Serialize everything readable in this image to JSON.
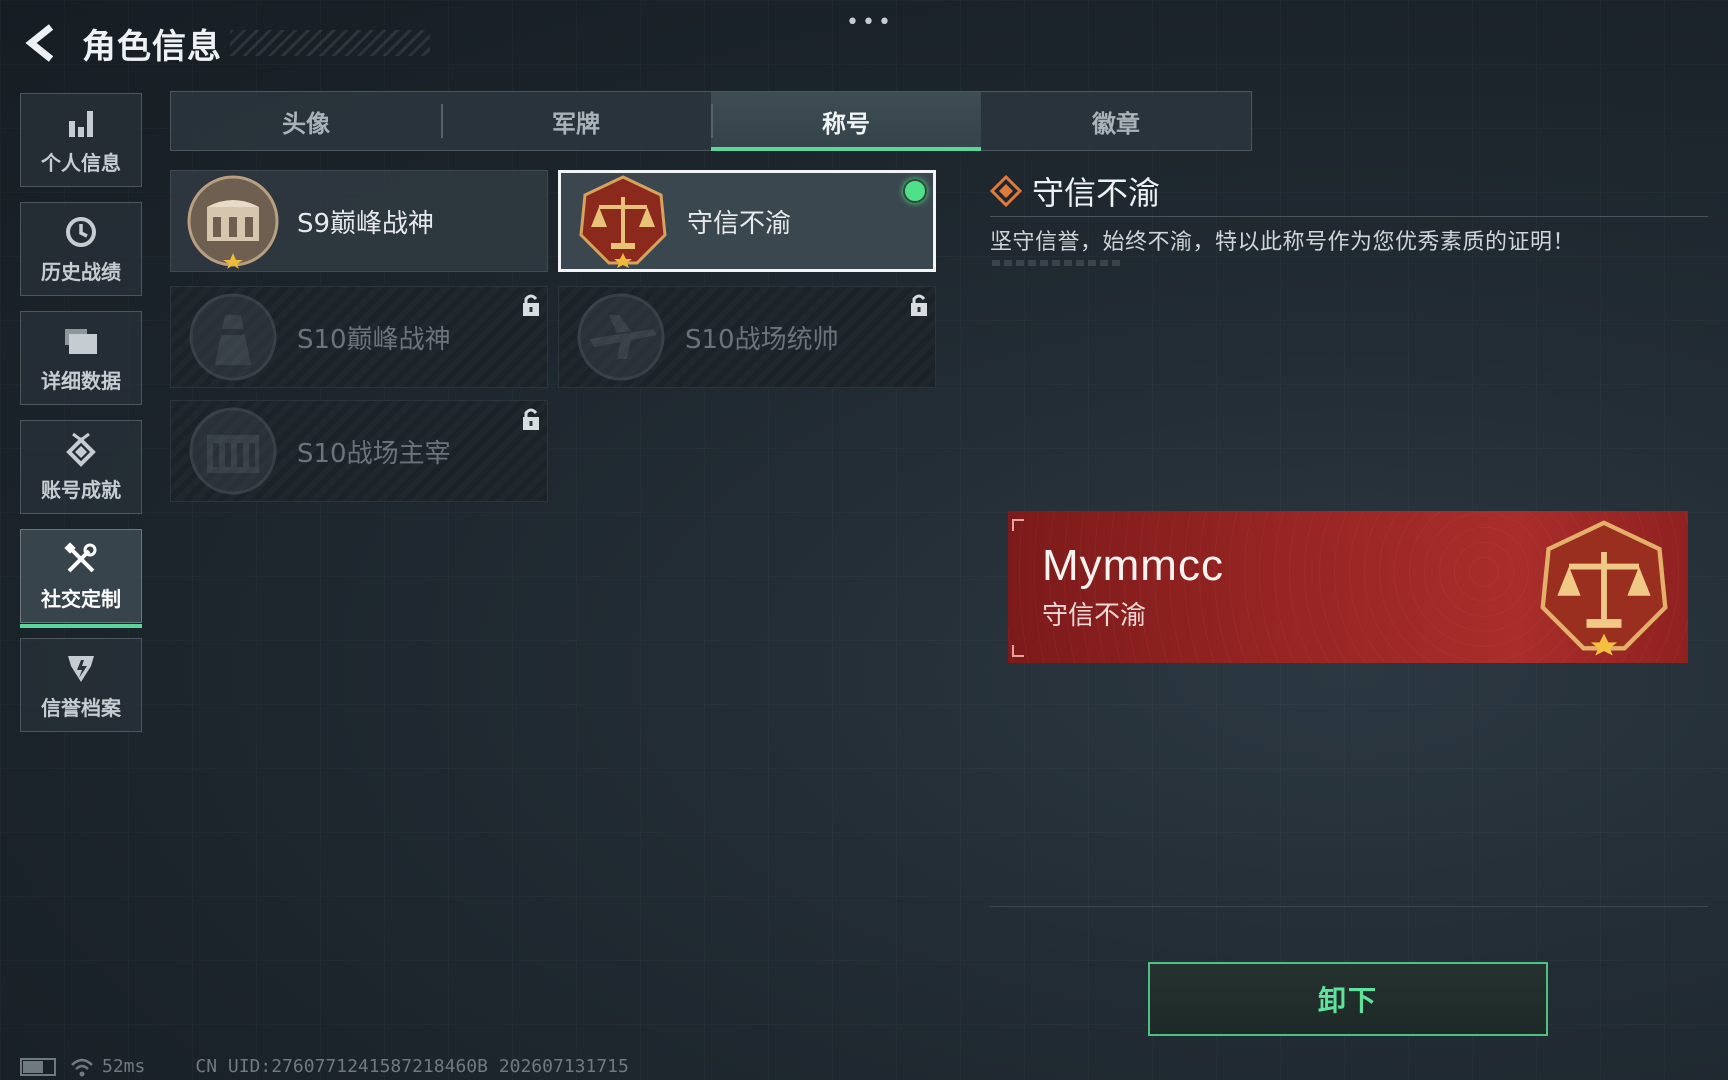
{
  "header": {
    "title": "角色信息",
    "menu_dots": "•••"
  },
  "sidebar": {
    "items": [
      {
        "label": "个人信息",
        "icon": "bar-chart-icon",
        "active": false
      },
      {
        "label": "历史战绩",
        "icon": "history-clock-icon",
        "active": false
      },
      {
        "label": "详细数据",
        "icon": "folder-icon",
        "active": false
      },
      {
        "label": "账号成就",
        "icon": "achievement-badge-icon",
        "active": false
      },
      {
        "label": "社交定制",
        "icon": "tools-icon",
        "active": true
      },
      {
        "label": "信誉档案",
        "icon": "credit-shield-icon",
        "active": false
      }
    ]
  },
  "tabs": [
    {
      "label": "头像",
      "active": false
    },
    {
      "label": "军牌",
      "active": false
    },
    {
      "label": "称号",
      "active": true
    },
    {
      "label": "徽章",
      "active": false
    }
  ],
  "titles": [
    {
      "name": "S9巅峰战神",
      "state": "unlocked"
    },
    {
      "name": "守信不渝",
      "state": "selected-equipped"
    },
    {
      "name": "S10巅峰战神",
      "state": "locked"
    },
    {
      "name": "S10战场统帅",
      "state": "locked"
    },
    {
      "name": "S10战场主宰",
      "state": "locked"
    }
  ],
  "detail": {
    "title": "守信不渝",
    "description": "坚守信誉，始终不渝，特以此称号作为您优秀素质的证明！"
  },
  "preview": {
    "player_name": "Mymmcc",
    "title": "守信不渝"
  },
  "actions": {
    "unequip_label": "卸下"
  },
  "status_bar": {
    "ping": "52ms",
    "uid": "CN UID:2760771241587218460B 202607131715"
  },
  "colors": {
    "accent": "#5cd59a",
    "banner": "#a92d2b",
    "equipped_dot": "#4fe08a"
  }
}
